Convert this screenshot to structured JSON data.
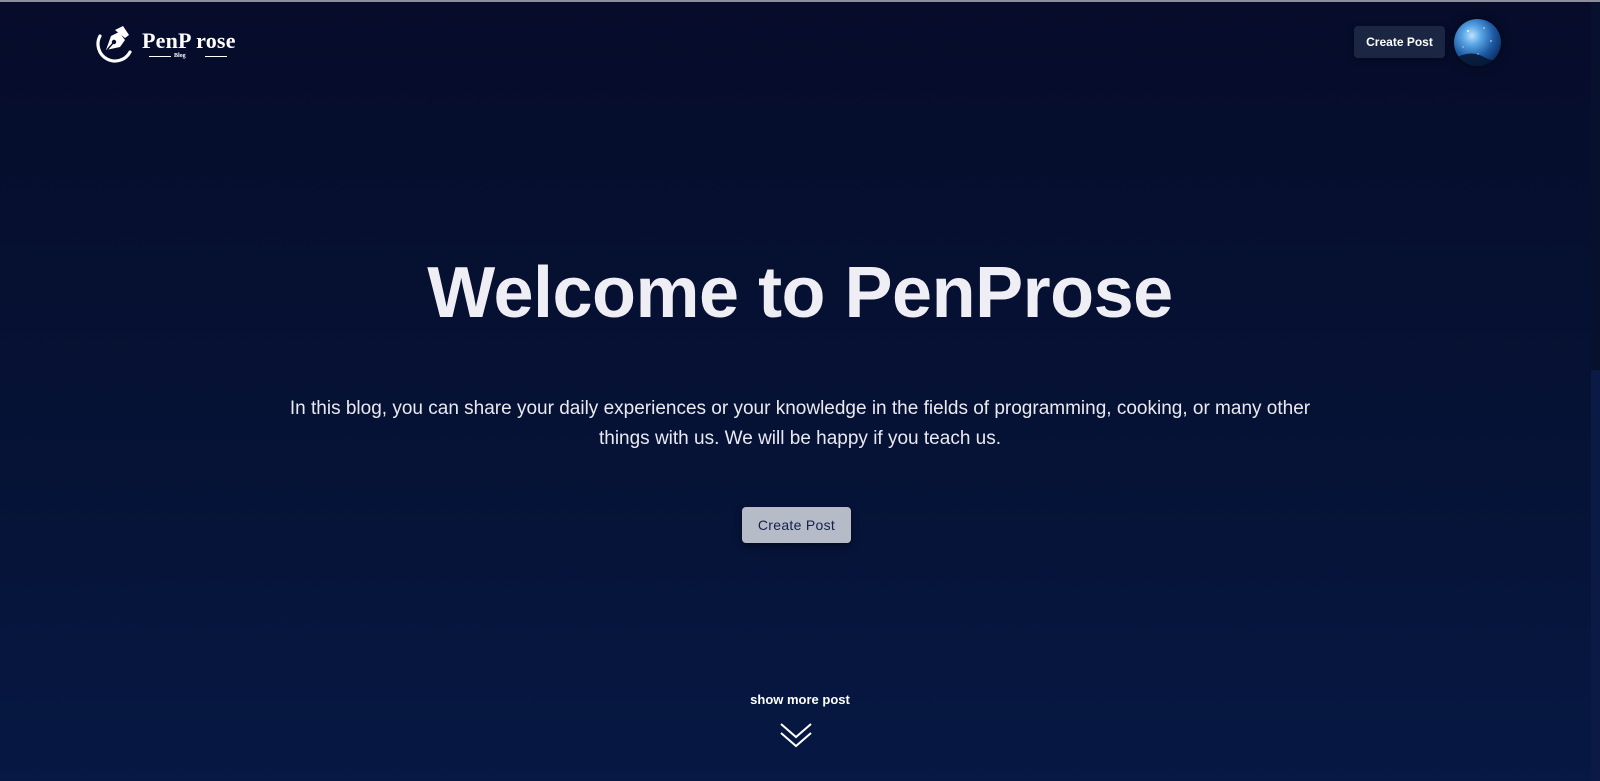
{
  "brand": {
    "name": "PenP rose",
    "tagline": "Blog",
    "logo_icon": "pen-nib-icon"
  },
  "header": {
    "create_post_label": "Create Post",
    "avatar_icon": "user-avatar"
  },
  "hero": {
    "title": "Welcome to PenProse",
    "description": "In this blog, you can share your daily experiences or your knowledge in the fields of programming, cooking, or many other things with us. We will be happy if you teach us.",
    "create_post_label": "Create Post"
  },
  "footer_hint": {
    "show_more_label": "show more post",
    "icon": "double-chevron-down-icon"
  },
  "colors": {
    "background_top": "#060c2a",
    "background_bottom": "#061843",
    "header_button": "#1b2742",
    "hero_button": "#b6bbc8",
    "hero_button_text": "#12224a"
  }
}
